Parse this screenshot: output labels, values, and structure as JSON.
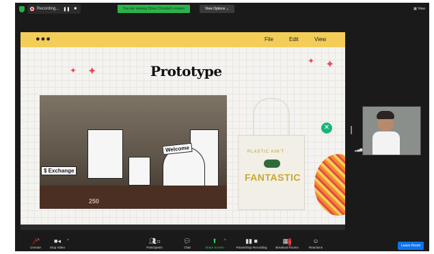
{
  "topbar": {
    "recording_label": "Recording...",
    "pause_glyph": "❚❚",
    "stop_glyph": "■",
    "share_banner": "You are viewing Olivia Christdel's screen",
    "view_options": "View Options ⌄",
    "view_label": "View"
  },
  "slide": {
    "menu": {
      "file": "File",
      "edit": "Edit",
      "view": "View"
    },
    "dots": "●●●",
    "title": "Prototype",
    "photo_sign_left": "$ Exchange",
    "photo_sign_welcome": "Welcome",
    "photo_sign_num": "250",
    "bag_text_top": "PLASTIC AIN'T",
    "bag_text_main": "FANTASTIC"
  },
  "toolbar": {
    "unmute": "Unmute",
    "stop_video": "Stop Video",
    "participants": "Participants",
    "participants_count": "72",
    "chat": "Chat",
    "share_screen": "Share Screen",
    "pause_recording": "Pause/Stop Recording",
    "breakout_rooms": "Breakout Rooms",
    "breakout_badge": "1",
    "reactions": "Reactions",
    "leave_room": "Leave Room"
  },
  "colors": {
    "banner_green": "#2bb34b",
    "slide_bar": "#f3cd58",
    "leave_blue": "#0e72ed"
  }
}
